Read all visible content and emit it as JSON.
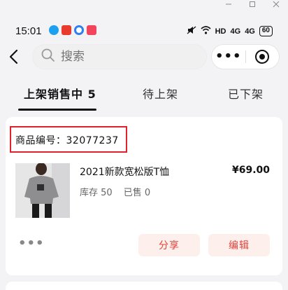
{
  "window": {
    "minimize_icon": "minus-icon",
    "maximize_icon": "square-icon",
    "close_icon": "close-icon"
  },
  "status_bar": {
    "time": "15:01",
    "network": "HD",
    "signal1": "4G",
    "signal2": "4G",
    "battery": "60"
  },
  "search": {
    "placeholder": "搜索"
  },
  "tabs": [
    {
      "label": "上架销售中 5",
      "active": true
    },
    {
      "label": "待上架",
      "active": false
    },
    {
      "label": "已下架",
      "active": false
    }
  ],
  "product": {
    "number_label": "商品编号：32077237",
    "title": "2021新款宽松版T恤",
    "price": "¥69.00",
    "stock": "库存 50",
    "sold": "已售 0",
    "share_label": "分享",
    "edit_label": "编辑",
    "more_label": "•••"
  },
  "colors": {
    "accent": "#e0423a",
    "highlight_box": "#e0202a",
    "button_bg": "#fdf0ec"
  }
}
